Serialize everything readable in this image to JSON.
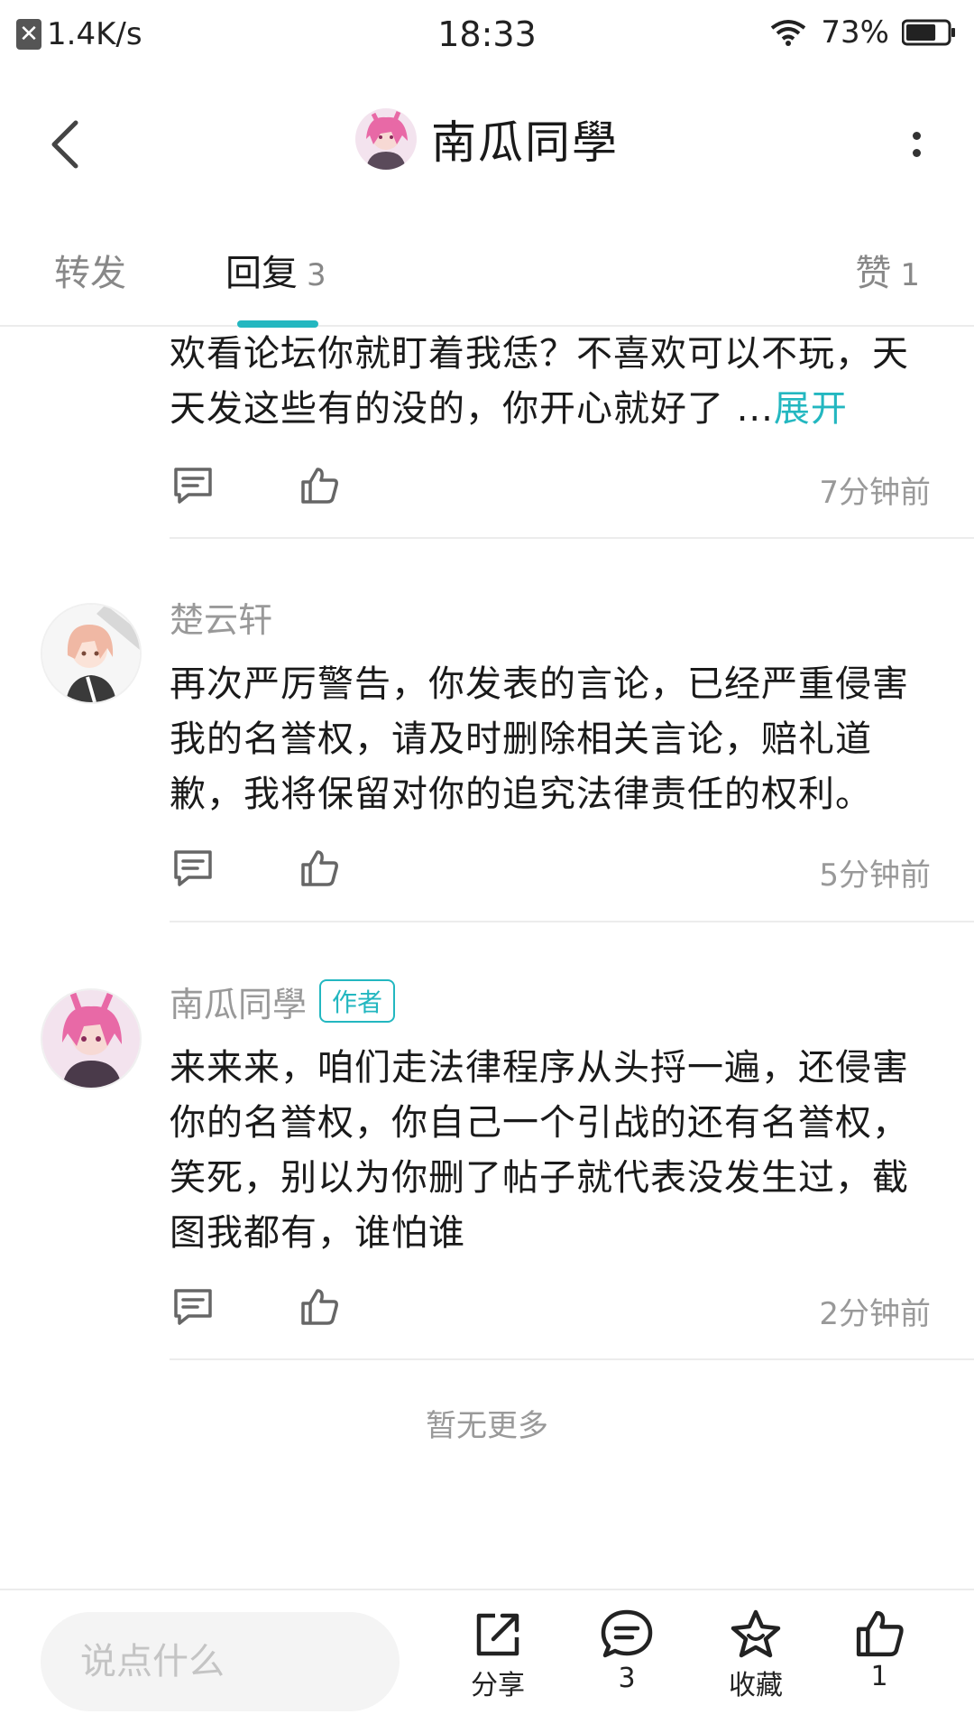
{
  "status_bar": {
    "net_speed": "1.4K/s",
    "time": "18:33",
    "battery_percent": "73%",
    "battery_level": 0.73
  },
  "header": {
    "title": "南瓜同學"
  },
  "tabs": {
    "forward": {
      "label": "转发"
    },
    "reply": {
      "label": "回复",
      "count": "3"
    },
    "like": {
      "label": "赞",
      "count": "1"
    }
  },
  "replies": [
    {
      "text": "欢看论坛你就盯着我恁？不喜欢可以不玩，天天发这些有的没的，你开心就好了 ...",
      "expand_label": "展开",
      "time": "7分钟前"
    },
    {
      "username": "楚云轩",
      "text": "再次严厉警告，你发表的言论，已经严重侵害我的名誉权，请及时删除相关言论，赔礼道歉，我将保留对你的追究法律责任的权利。",
      "time": "5分钟前"
    },
    {
      "username": "南瓜同學",
      "badge": "作者",
      "text": "来来来，咱们走法律程序从头捋一遍，还侵害你的名誉权，你自己一个引战的还有名誉权，笑死，别以为你删了帖子就代表没发生过，截图我都有，谁怕谁",
      "time": "2分钟前"
    }
  ],
  "no_more": "暂无更多",
  "bottom_bar": {
    "input_placeholder": "说点什么",
    "share_label": "分享",
    "comment_count": "3",
    "favorite_label": "收藏",
    "like_count": "1"
  },
  "colors": {
    "accent": "#23b7c0",
    "text_primary": "#1a1a1a",
    "text_secondary": "#999999",
    "divider": "#ececec"
  }
}
